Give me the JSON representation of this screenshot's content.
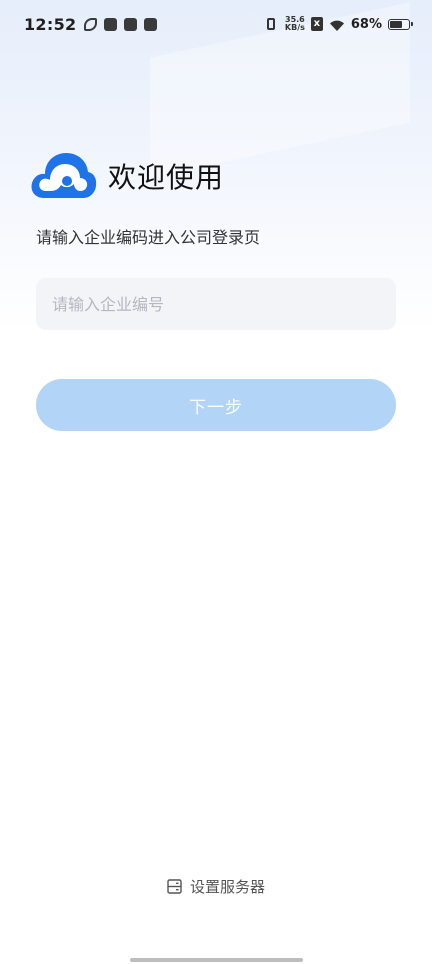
{
  "status_bar": {
    "time": "12:52",
    "net_speed_value": "35.6",
    "net_speed_unit": "KB/s",
    "sim_label": "x",
    "battery_percent": "68%",
    "battery_level": 0.68
  },
  "header": {
    "title": "欢迎使用",
    "subtitle": "请输入企业编码进入公司登录页"
  },
  "form": {
    "company_code": {
      "value": "",
      "placeholder": "请输入企业编号"
    },
    "next_label": "下一步"
  },
  "footer": {
    "server_settings_label": "设置服务器"
  },
  "colors": {
    "brand": "#1e73e8",
    "button_disabled": "#b2d4f6",
    "input_bg": "#f3f4f8"
  },
  "icons": [
    "cloud-logo-icon",
    "server-icon",
    "wifi-icon",
    "battery-icon",
    "vibrate-icon"
  ]
}
